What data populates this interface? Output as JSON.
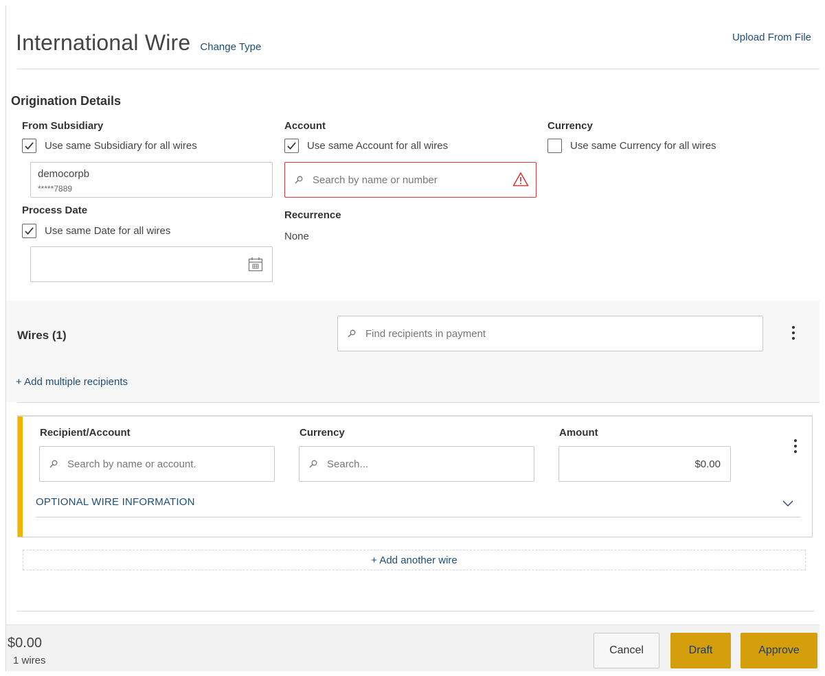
{
  "header": {
    "title": "International Wire",
    "change_type": "Change Type",
    "upload_from_file": "Upload From File"
  },
  "origination": {
    "section_title": "Origination Details",
    "from_subsidiary": {
      "label": "From Subsidiary",
      "checkbox_label": "Use same Subsidiary for all wires",
      "checked": true,
      "selected_name": "democorpb",
      "selected_account": "*****7889"
    },
    "account": {
      "label": "Account",
      "checkbox_label": "Use same Account for all wires",
      "checked": true,
      "search_placeholder": "Search by name or number",
      "error_color": "#d23b3b"
    },
    "currency": {
      "label": "Currency",
      "checkbox_label": "Use same Currency for all wires",
      "checked": false
    },
    "process_date": {
      "label": "Process Date",
      "checkbox_label": "Use same Date for all wires",
      "checked": true,
      "value": ""
    },
    "recurrence": {
      "label": "Recurrence",
      "value": "None"
    }
  },
  "wires": {
    "title": "Wires (1)",
    "find_placeholder": "Find recipients in payment",
    "add_multiple": "+ Add multiple recipients",
    "items": [
      {
        "recipient_label": "Recipient/Account",
        "recipient_placeholder": "Search by name or account.",
        "currency_label": "Currency",
        "currency_placeholder": "Search...",
        "amount_label": "Amount",
        "amount_value": "$0.00",
        "optional_info": "OPTIONAL WIRE INFORMATION",
        "accent_color": "#f2b200"
      }
    ],
    "add_another": "+ Add another wire"
  },
  "footer": {
    "total_amount": "$0.00",
    "total_count": "1 wires",
    "cancel_label": "Cancel",
    "draft_label": "Draft",
    "approve_label": "Approve",
    "primary_color": "#d49f0b"
  }
}
